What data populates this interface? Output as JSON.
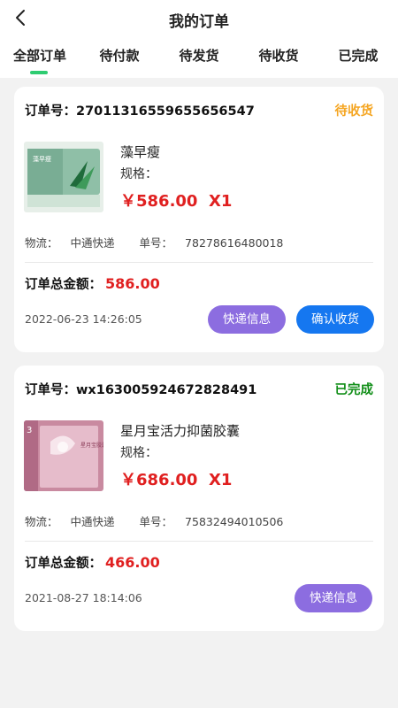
{
  "header": {
    "title": "我的订单"
  },
  "tabs": [
    {
      "label": "全部订单",
      "active": true
    },
    {
      "label": "待付款"
    },
    {
      "label": "待发货"
    },
    {
      "label": "待收货"
    },
    {
      "label": "已完成"
    }
  ],
  "colors": {
    "accent": "#2ecc71",
    "price": "#e02020",
    "pending": "#f5a623",
    "done": "#138f1a",
    "express_btn": "#8c6de0",
    "confirm_btn": "#1577f0"
  },
  "orders": [
    {
      "order_no_label": "订单号：",
      "order_no": "27011316559655656547",
      "status": "待收货",
      "product_name": "藻早瘦",
      "spec_label": "规格：",
      "price": "￥586.00",
      "quantity": "X1",
      "logistics_label": "物流：",
      "carrier": "中通快递",
      "tracking_label": "单号：",
      "tracking_no": "78278616480018",
      "total_label": "订单总金额：",
      "total": "586.00",
      "date": "2022-06-23 14:26:05",
      "btn_express": "快递信息",
      "btn_confirm": "确认收货",
      "thumb_text": "藻早瘦"
    },
    {
      "order_no_label": "订单号：",
      "order_no": "wx163005924672828491",
      "status": "已完成",
      "product_name": "星月宝活力抑菌胶囊",
      "spec_label": "规格：",
      "price": "￥686.00",
      "quantity": "X1",
      "logistics_label": "物流：",
      "carrier": "中通快递",
      "tracking_label": "单号：",
      "tracking_no": "75832494010506",
      "total_label": "订单总金额：",
      "total": "466.00",
      "date": "2021-08-27 18:14:06",
      "btn_express": "快递信息",
      "thumb_text": "星月宝胶囊·三盒"
    }
  ]
}
